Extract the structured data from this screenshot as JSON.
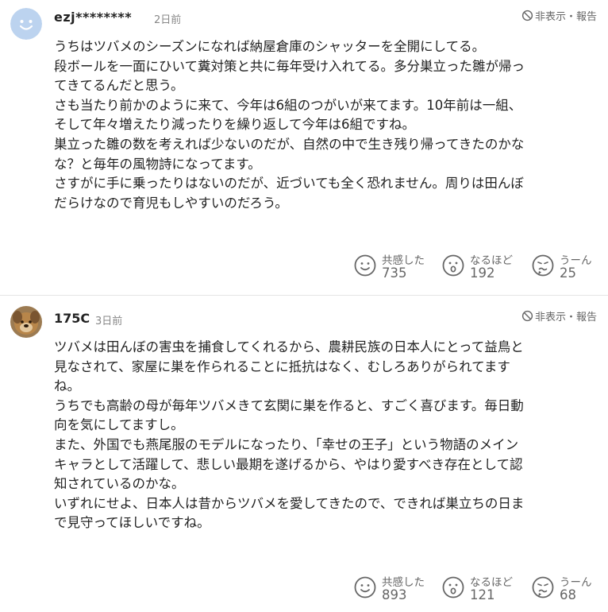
{
  "colors": {
    "text": "#222222",
    "muted": "#888888",
    "icon": "#666666",
    "divider": "#e5e5e5",
    "default_avatar_bg": "#bcd3ef"
  },
  "comments": [
    {
      "username": "ezj********",
      "time": "2日前",
      "report_label": "非表示・報告",
      "avatar": "default-smile-avatar",
      "body_lines": [
        "うちはツバメのシーズンになれば納屋倉庫のシャッターを全開にしてる。",
        "段ボールを一面にひいて糞対策と共に毎年受け入れてる。多分巣立った雛が帰っ",
        "てきてるんだと思う。",
        "さも当たり前かのように来て、今年は6組のつがいが来てます。10年前は一組、",
        "そして年々増えたり減ったりを繰り返して今年は6組ですね。",
        "巣立った雛の数を考えれば少ないのだが、自然の中で生き残り帰ってきたのかな",
        "な？と毎年の風物詩になってます。",
        "さすがに手に乗ったりはないのだが、近づいても全く恐れません。周りは田んぼ",
        "だらけなので育児もしやすいのだろう。"
      ],
      "reactions": [
        {
          "label": "共感した",
          "count": "735",
          "icon": "empathy-icon"
        },
        {
          "label": "なるほど",
          "count": "192",
          "icon": "surprised-icon"
        },
        {
          "label": "うーん",
          "count": "25",
          "icon": "hmm-icon"
        }
      ]
    },
    {
      "username": "175C",
      "time": "3日前",
      "report_label": "非表示・報告",
      "avatar": "dog-photo-avatar",
      "body_lines": [
        "ツバメは田んぼの害虫を捕食してくれるから、農耕民族の日本人にとって益鳥と",
        "見なされて、家屋に巣を作られることに抵抗はなく、むしろありがられてます",
        "ね。",
        "うちでも高齢の母が毎年ツバメきて玄関に巣を作ると、すごく喜びます。毎日動",
        "向を気にしてますし。",
        "また、外国でも燕尾服のモデルになったり、「幸せの王子」という物語のメイン",
        "キャラとして活躍して、悲しい最期を遂げるから、やはり愛すべき存在として認",
        "知されているのかな。",
        "いずれにせよ、日本人は昔からツバメを愛してきたので、できれば巣立ちの日ま",
        "で見守ってほしいですね。"
      ],
      "reactions": [
        {
          "label": "共感した",
          "count": "893",
          "icon": "empathy-icon"
        },
        {
          "label": "なるほど",
          "count": "121",
          "icon": "surprised-icon"
        },
        {
          "label": "うーん",
          "count": "68",
          "icon": "hmm-icon"
        }
      ]
    }
  ]
}
